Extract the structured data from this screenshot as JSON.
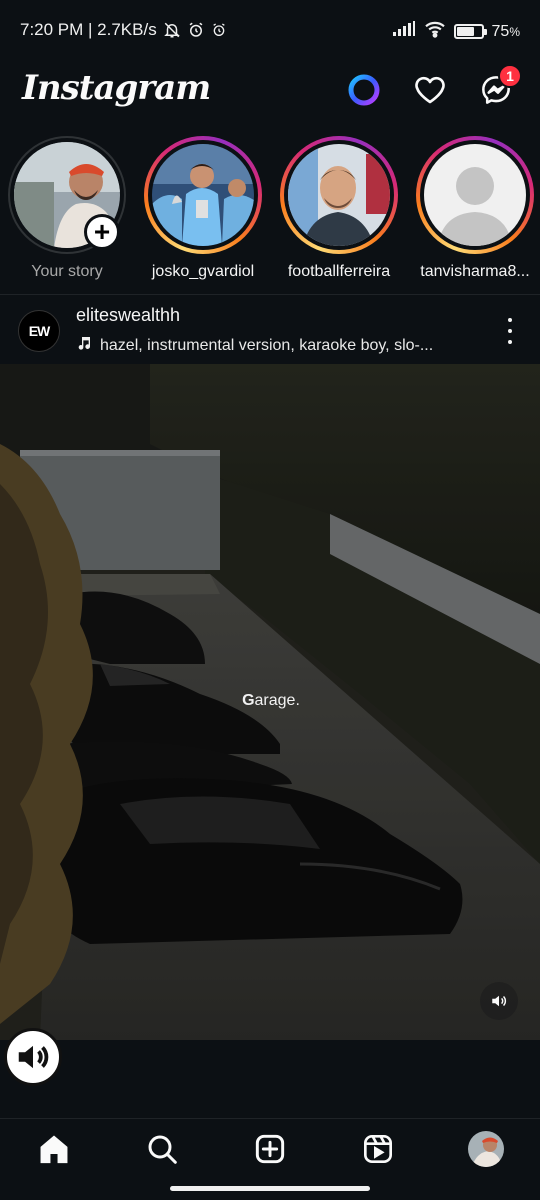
{
  "status_bar": {
    "time_speed": "7:20 PM | 2.7KB/s",
    "battery": "75",
    "battery_unit": "%",
    "battery_level": 0.75,
    "icons": [
      "mute-bell-icon",
      "alarm-icon",
      "alarm-icon",
      "signal-icon",
      "wifi-icon",
      "battery-icon"
    ]
  },
  "header": {
    "logo": "Instagram",
    "messenger_badge": "1",
    "icons": [
      "meta-ai-icon",
      "heart-icon",
      "messenger-icon"
    ]
  },
  "stories": [
    {
      "name": "Your story",
      "own": true
    },
    {
      "name": "josko_gvardiol",
      "own": false
    },
    {
      "name": "footballferreira",
      "own": false
    },
    {
      "name": "tanvisharma8...",
      "own": false
    }
  ],
  "post": {
    "avatar_text": "EW",
    "username": "eliteswealthh",
    "audio": "hazel, instrumental version, karaoke boy, slo-...",
    "caption_first": "G",
    "caption_rest": "arage."
  },
  "colors": {
    "background": "#0c1014",
    "badge": "#ff3040",
    "text": "#f5f5f5",
    "muted_text": "#a8a8a8"
  },
  "nav": {
    "items": [
      "home-icon",
      "search-icon",
      "create-icon",
      "reels-icon",
      "profile-avatar"
    ]
  }
}
